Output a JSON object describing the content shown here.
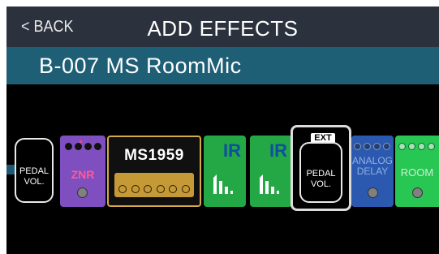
{
  "header": {
    "back_label": "< BACK",
    "title": "ADD EFFECTS"
  },
  "patch": {
    "name": "B-007 MS RoomMic"
  },
  "effects": [
    {
      "label_line1": "PEDAL",
      "label_line2": "VOL."
    },
    {
      "label": "ZNR"
    },
    {
      "label": "MS1959"
    },
    {
      "label": "IR"
    },
    {
      "label": "IR"
    },
    {
      "badge": "EXT",
      "label_line1": "PEDAL",
      "label_line2": "VOL."
    },
    {
      "label_line1": "ANALOG",
      "label_line2": "DELAY"
    },
    {
      "label": "ROOM"
    }
  ],
  "colors": {
    "header_bg": "#2b323d",
    "patch_bg": "#1f5f76",
    "chain_line": "#1d5878",
    "znr": "#7f4fbf",
    "amp_gold": "#c59a36",
    "ir_green": "#24a845",
    "analog_blue": "#2c59b0",
    "room_green": "#28c653"
  },
  "icons": {
    "ir": "impulse-response-bars-icon",
    "knob": "knob-icon",
    "footswitch": "footswitch-icon",
    "chain_cable": "cable-connector-icon"
  }
}
